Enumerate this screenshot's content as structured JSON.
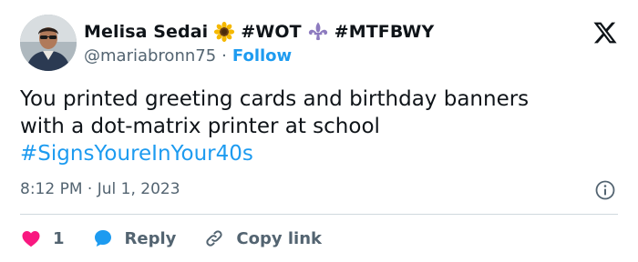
{
  "tweet": {
    "author": {
      "name_part1": "Melisa Sedai",
      "name_part2": "#WOT",
      "name_part3": "#MTFBWY",
      "emoji_1": "sunflower-emoji",
      "emoji_2": "fleur-de-lis-emoji",
      "handle": "@mariabronn75",
      "separator": "·",
      "follow_label": "Follow"
    },
    "text_line_1": "You printed greeting cards and birthday banners",
    "text_line_2": "with a dot-matrix printer at school",
    "hashtag": "#SignsYoureInYour40s",
    "timestamp": "8:12 PM · Jul 1, 2023",
    "actions": {
      "like_count": "1",
      "reply_label": "Reply",
      "copy_label": "Copy link"
    }
  },
  "icons": {
    "platform": "x-logo-icon",
    "info": "info-icon",
    "like": "heart-icon",
    "reply": "speech-bubble-icon",
    "copy": "link-icon"
  },
  "colors": {
    "accent": "#1d9bf0",
    "like": "#f91880",
    "text": "#0f1419",
    "muted": "#536471",
    "divider": "#cfd9de"
  }
}
